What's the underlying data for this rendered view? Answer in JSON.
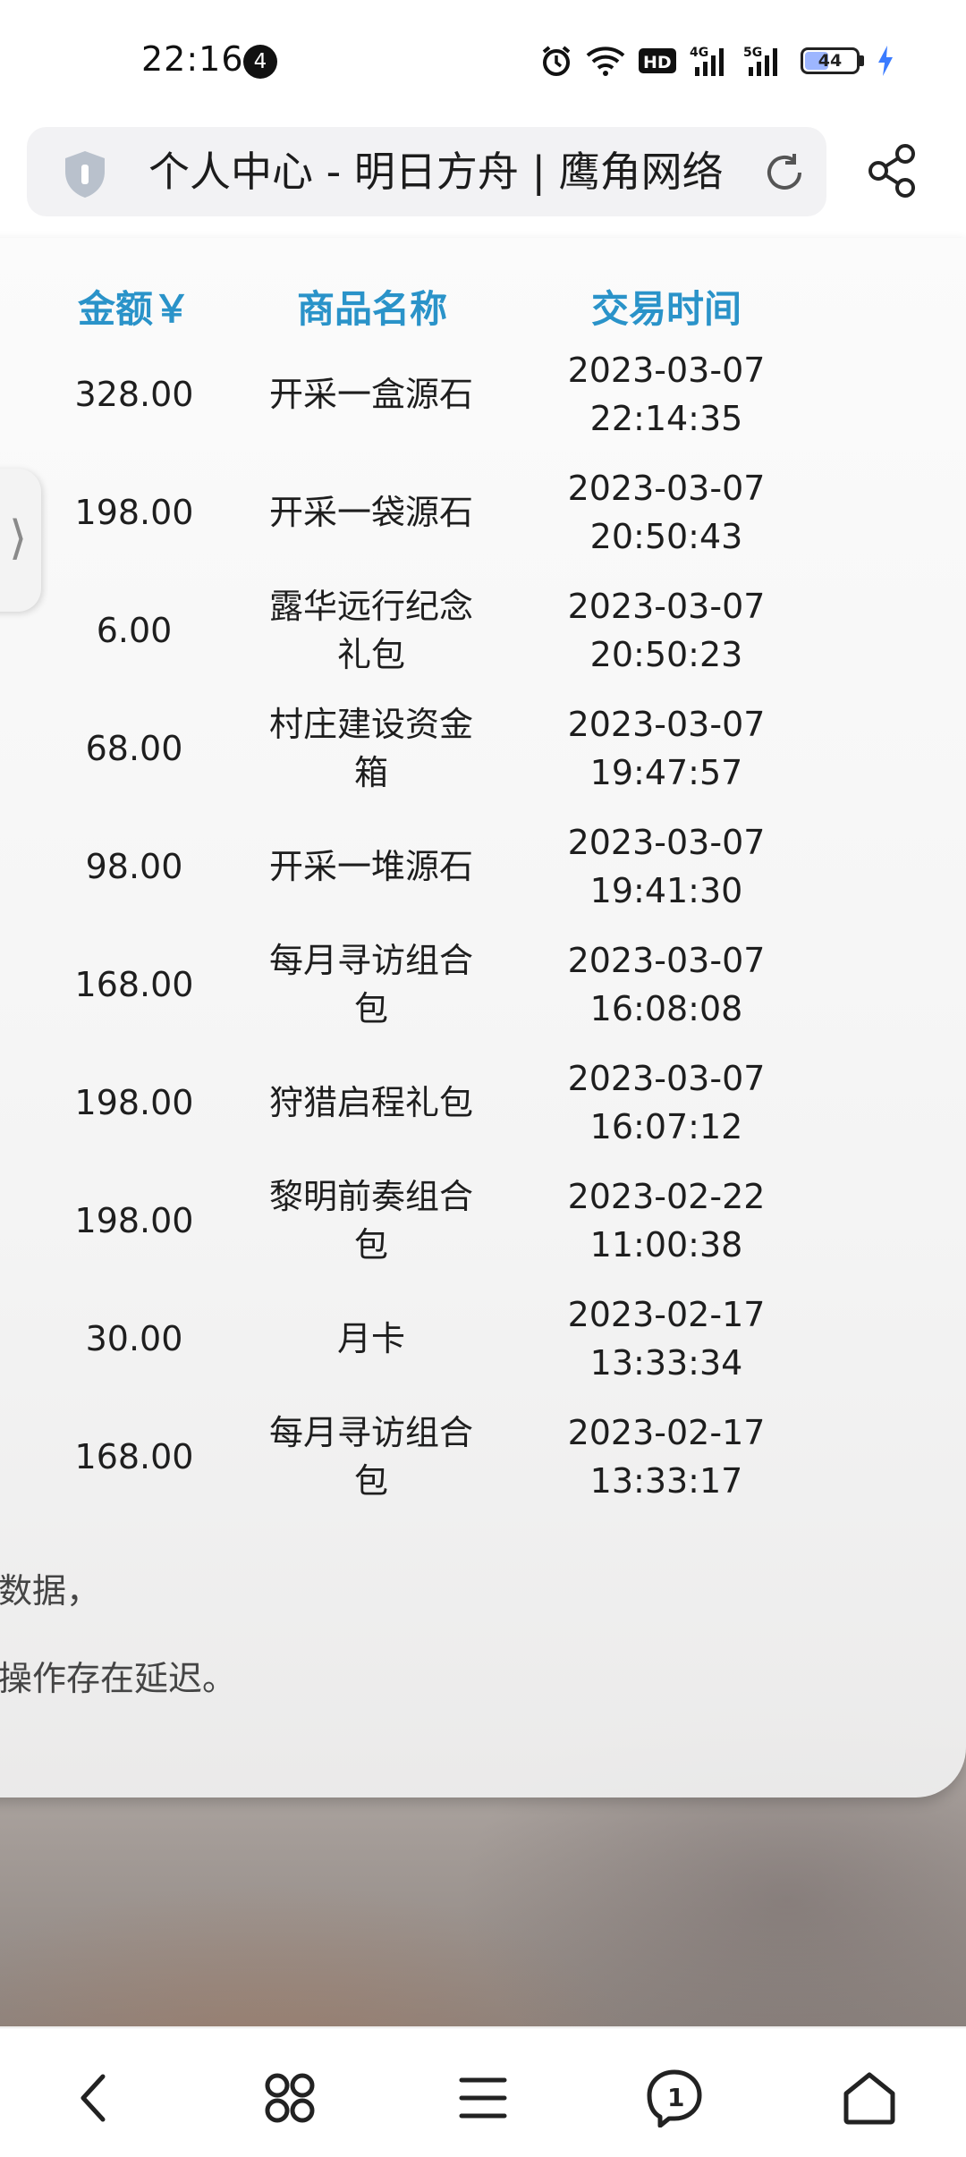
{
  "status_bar": {
    "time": "22:16",
    "notification_count": "4",
    "network_hd": "HD",
    "network_4g": "4G",
    "network_5g": "5G",
    "battery": "44",
    "battery_level_percent": 44,
    "icons": [
      "alarm-icon",
      "wifi-icon",
      "hd-icon",
      "signal-4g-icon",
      "signal-5g-icon",
      "battery-icon",
      "charging-icon"
    ]
  },
  "browser": {
    "page_title": "个人中心 - 明日方舟 | 鹰角网络",
    "icons": [
      "shield-icon",
      "refresh-icon",
      "share-icon"
    ]
  },
  "table": {
    "headers": [
      "金额￥",
      "商品名称",
      "交易时间"
    ],
    "rows": [
      {
        "amount": "328.00",
        "name": [
          "开采一盒源石"
        ],
        "date": "2023-03-07",
        "time": "22:14:35"
      },
      {
        "amount": "198.00",
        "name": [
          "开采一袋源石"
        ],
        "date": "2023-03-07",
        "time": "20:50:43"
      },
      {
        "amount": "6.00",
        "name": [
          "露华远行纪念",
          "礼包"
        ],
        "date": "2023-03-07",
        "time": "20:50:23"
      },
      {
        "amount": "68.00",
        "name": [
          "村庄建设资金",
          "箱"
        ],
        "date": "2023-03-07",
        "time": "19:47:57"
      },
      {
        "amount": "98.00",
        "name": [
          "开采一堆源石"
        ],
        "date": "2023-03-07",
        "time": "19:41:30"
      },
      {
        "amount": "168.00",
        "name": [
          "每月寻访组合",
          "包"
        ],
        "date": "2023-03-07",
        "time": "16:08:08"
      },
      {
        "amount": "198.00",
        "name": [
          "狩猎启程礼包"
        ],
        "date": "2023-03-07",
        "time": "16:07:12"
      },
      {
        "amount": "198.00",
        "name": [
          "黎明前奏组合",
          "包"
        ],
        "date": "2023-02-22",
        "time": "11:00:38"
      },
      {
        "amount": "30.00",
        "name": [
          "月卡"
        ],
        "date": "2023-02-17",
        "time": "13:33:34"
      },
      {
        "amount": "168.00",
        "name": [
          "每月寻访组合",
          "包"
        ],
        "date": "2023-02-17",
        "time": "13:33:17"
      }
    ]
  },
  "notes": [
    "数据，",
    "操作存在延迟。"
  ],
  "side_handle": {
    "glyph": "⟩"
  },
  "bottom_nav": {
    "icons": [
      "back-icon",
      "apps-icon",
      "menu-icon",
      "tabs-icon",
      "home-icon"
    ],
    "tab_count": "1"
  },
  "colors": {
    "header_text": "#2a93c9",
    "accent_battery": "#9db6ff",
    "charging": "#3a7bff"
  }
}
